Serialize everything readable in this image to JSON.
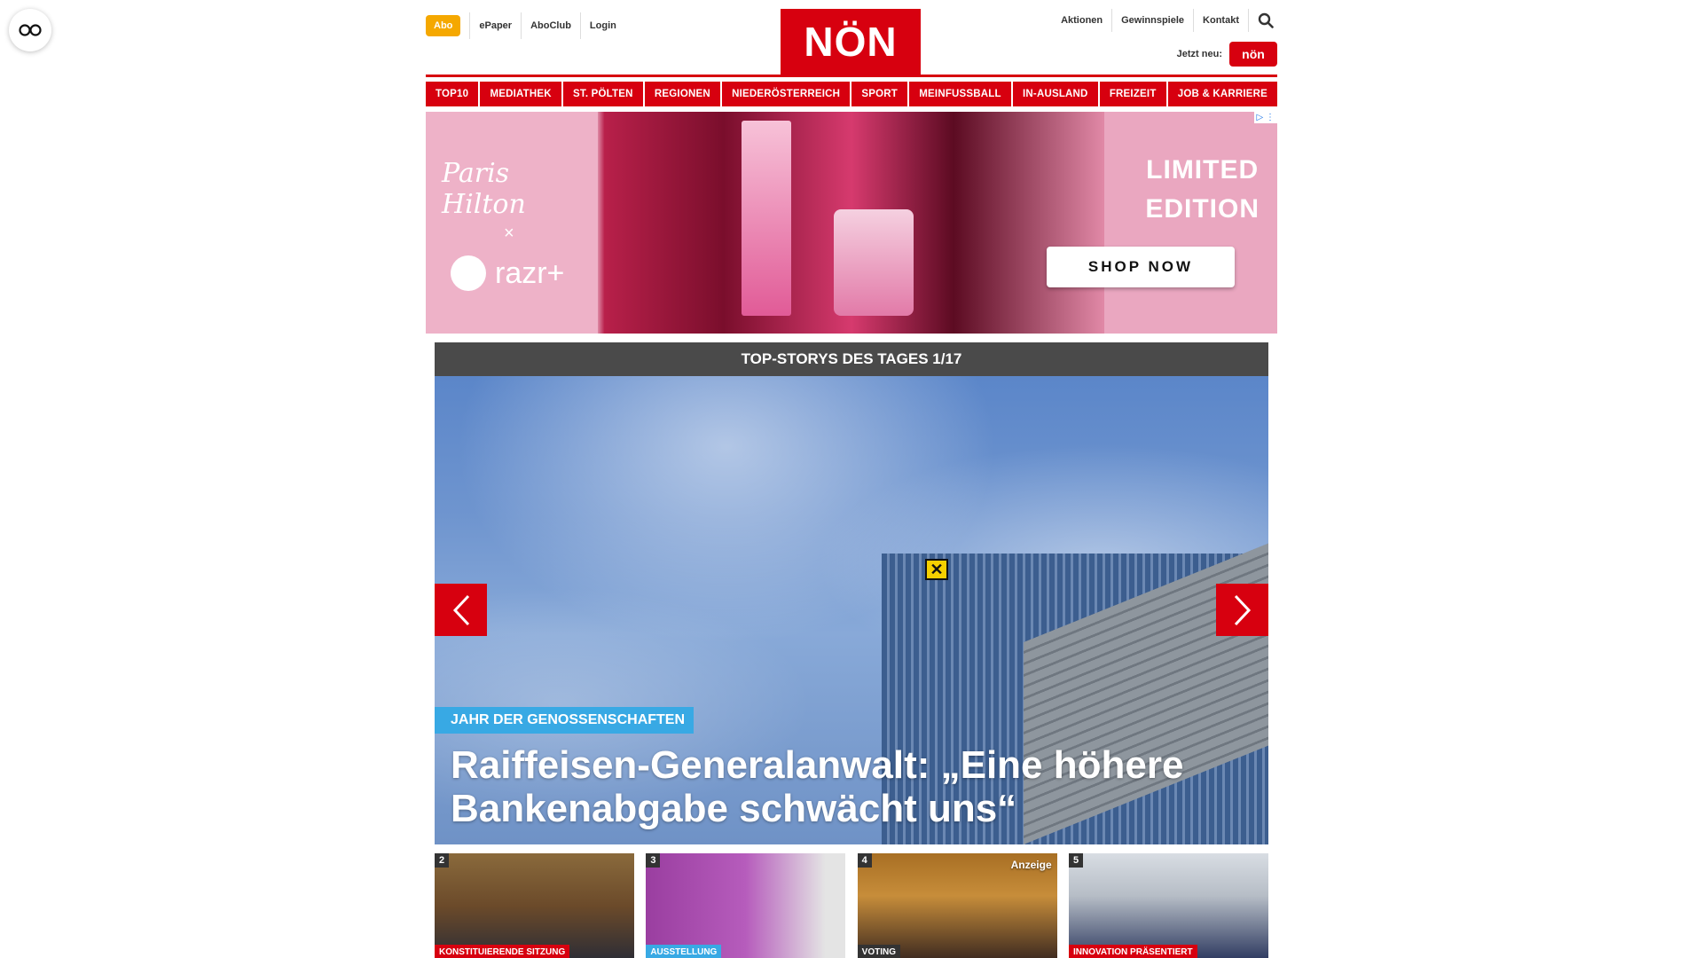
{
  "header": {
    "abo": "Abo",
    "left_links": [
      "ePaper",
      "AboClub",
      "Login"
    ],
    "logo": "NÖN",
    "right_links": [
      "Aktionen",
      "Gewinnspiele",
      "Kontakt"
    ],
    "jetzt_neu": "Jetzt neu:",
    "kleine_label": "nön"
  },
  "nav": [
    "TOP10",
    "MEDIATHEK",
    "ST. PÖLTEN",
    "REGIONEN",
    "NIEDERÖSTERREICH",
    "SPORT",
    "MEINFUSSBALL",
    "IN-AUSLAND",
    "FREIZEIT",
    "JOB & KARRIERE"
  ],
  "ad": {
    "signature": "Paris Hilton",
    "x": "×",
    "brand": "razr+",
    "headline_line1": "LIMITED",
    "headline_line2": "EDITION",
    "cta": "SHOP NOW",
    "adchoices": "▷ ⋮"
  },
  "slider": {
    "title": "TOP-STORYS DES TAGES 1/17",
    "kicker": "JAHR DER GENOSSENSCHAFTEN",
    "headline": "Raiffeisen-Generalanwalt: „Eine höhere Bankenabgabe schwächt uns“"
  },
  "thumbs": [
    {
      "num": "2",
      "tag": "KONSTITUIERENDE SITZUNG",
      "tag_color": "#d7000f",
      "anzeige": ""
    },
    {
      "num": "3",
      "tag": "AUSSTELLUNG",
      "tag_color": "#38a9e4",
      "anzeige": ""
    },
    {
      "num": "4",
      "tag": "VOTING",
      "tag_color": "#333333",
      "anzeige": "Anzeige"
    },
    {
      "num": "5",
      "tag": "INNOVATION PRÄSENTIERT",
      "tag_color": "#d7000f",
      "anzeige": ""
    }
  ],
  "colors": {
    "brand_red": "#d7000f",
    "abo_orange": "#f5a800",
    "kicker_blue": "#38a9e4"
  }
}
